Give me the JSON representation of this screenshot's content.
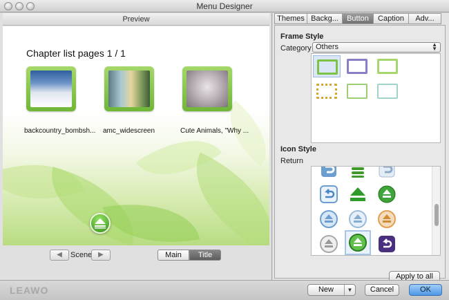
{
  "window": {
    "title": "Menu Designer"
  },
  "preview": {
    "header": "Preview",
    "chapter_title": "Chapter list pages 1 / 1",
    "thumbnails": [
      {
        "label": "backcountry_bombsh..."
      },
      {
        "label": "amc_widescreen"
      },
      {
        "label": "Cute Animals, \"Why ..."
      }
    ],
    "scene_label": "Scene",
    "segments": {
      "main": "Main",
      "title": "Title"
    }
  },
  "tabs": [
    {
      "label": "Themes",
      "active": false
    },
    {
      "label": "Backg...",
      "active": false
    },
    {
      "label": "Button",
      "active": true
    },
    {
      "label": "Caption",
      "active": false
    },
    {
      "label": "Adv...",
      "active": false
    }
  ],
  "frame_style": {
    "heading": "Frame Style",
    "category_label": "Category",
    "category_value": "Others"
  },
  "icon_style": {
    "heading": "Icon Style",
    "sub_label": "Return"
  },
  "buttons": {
    "apply_all": "Apply to all",
    "new": "New",
    "cancel": "Cancel",
    "ok": "OK"
  },
  "branding": {
    "logo": "LEAWO"
  },
  "colors": {
    "accent_green": "#6fb637",
    "frame_green": "#7cc243",
    "frame_purple": "#8b7dc6",
    "frame_gold": "#d6a52f",
    "frame_teal": "#9fd3c9",
    "icon_blue": "#6c9fd0",
    "icon_orange": "#e0a04f",
    "icon_purple": "#4b2f7f",
    "ok_blue": "#4d97e6"
  }
}
